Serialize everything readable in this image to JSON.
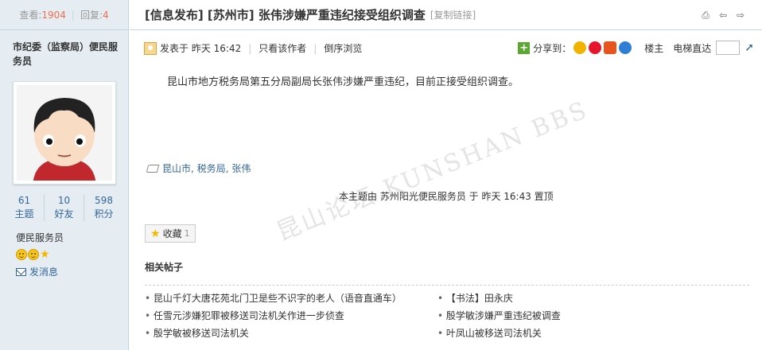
{
  "stats": {
    "views_label": "查看:",
    "views": "1904",
    "replies_label": "回复:",
    "replies": "4"
  },
  "author": {
    "name": "市纪委（监察局）便民服务员",
    "counts": [
      {
        "value": "61",
        "label": "主题"
      },
      {
        "value": "10",
        "label": "好友"
      },
      {
        "value": "598",
        "label": "积分"
      }
    ],
    "group": "便民服务员",
    "message_link": "发消息"
  },
  "thread": {
    "title": "[信息发布] [苏州市] 张伟涉嫌严重违纪接受组织调查",
    "copy_link": "[复制链接]"
  },
  "post": {
    "posted_at": "发表于 昨天 16:42",
    "only_author": "只看该作者",
    "reverse": "倒序浏览",
    "share_label": "分享到：",
    "floor_label": "楼主",
    "elevator_label": "电梯直达",
    "text": "昆山市地方税务局第五分局副局长张伟涉嫌严重违纪，目前正接受组织调查。",
    "tags": [
      "昆山市",
      "税务局",
      "张伟"
    ],
    "stick_note": "本主题由 苏州阳光便民服务员 于 昨天 16:43 置顶",
    "watermark": "昆山论坛 KUNSHAN BBS",
    "favorite_label": "收藏",
    "favorite_count": "1"
  },
  "related": {
    "title": "相关帖子",
    "items": [
      "昆山千灯大唐花苑北门卫是些不识字的老人（语音直通车）",
      "【书法】田永庆",
      "任雪元涉嫌犯罪被移送司法机关作进一步侦查",
      "殷学敏涉嫌严重违纪被调查",
      "殷学敏被移送司法机关",
      "叶凤山被移送司法机关"
    ]
  },
  "colors": {
    "link": "#336699",
    "sidebar": "#e5edf2",
    "accent": "#f26c4f"
  }
}
